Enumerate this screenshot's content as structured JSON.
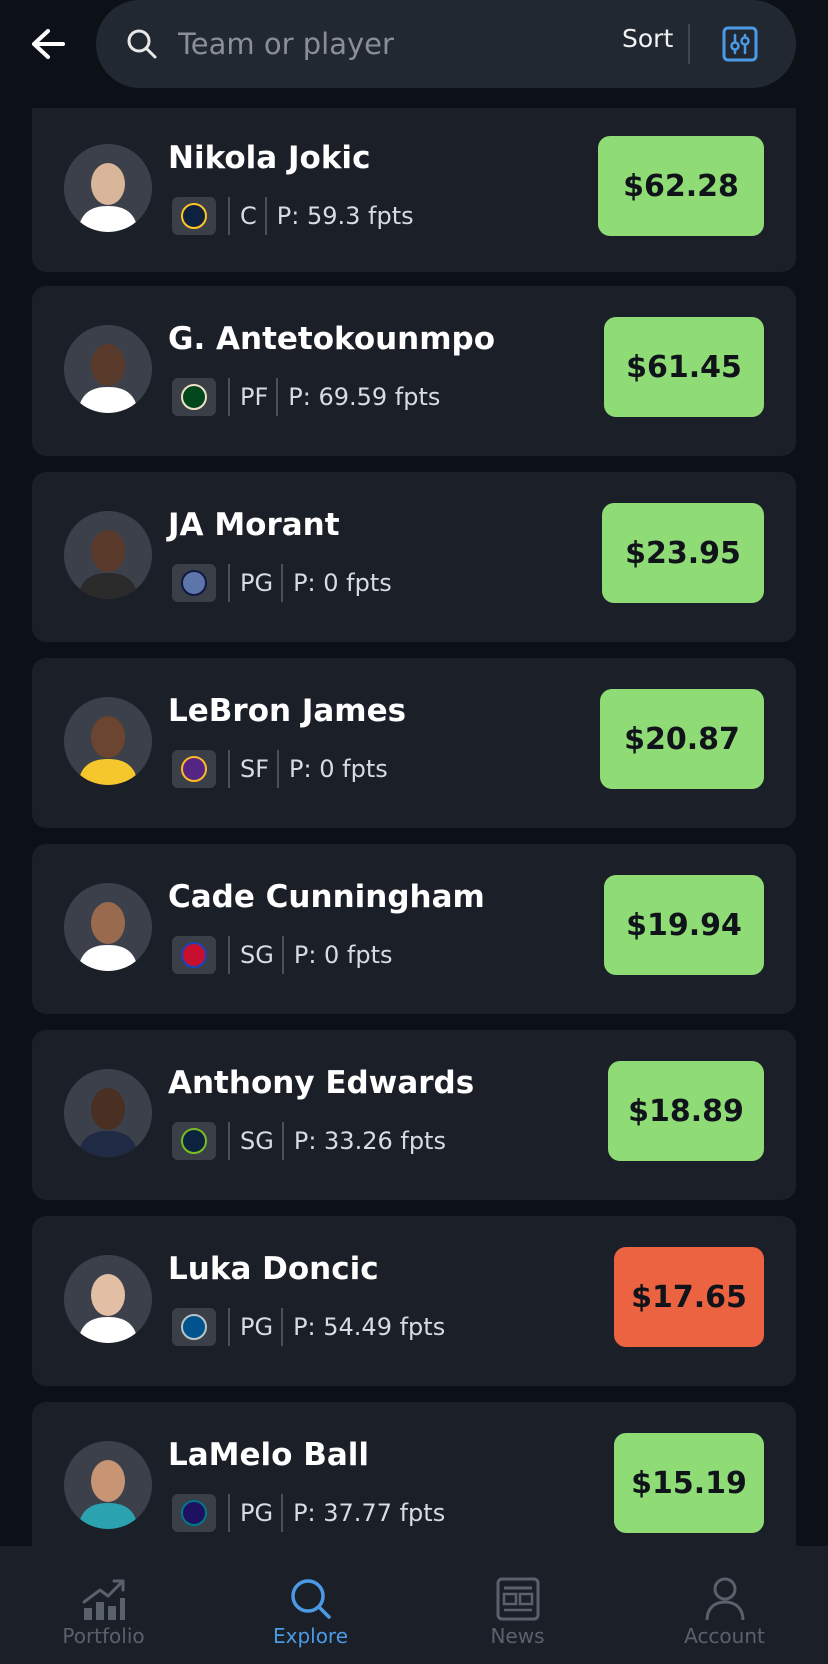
{
  "search": {
    "placeholder": "Team or player",
    "sort_label": "Sort"
  },
  "players": [
    {
      "name": "Nikola Jokic",
      "position": "C",
      "projection": "P: 59.3 fpts",
      "price": "$62.28",
      "trend": "up",
      "team_icon": "nuggets-logo-icon"
    },
    {
      "name": "G. Antetokounmpo",
      "position": "PF",
      "projection": "P: 69.59 fpts",
      "price": "$61.45",
      "trend": "up",
      "team_icon": "bucks-logo-icon"
    },
    {
      "name": "JA Morant",
      "position": "PG",
      "projection": "P: 0 fpts",
      "price": "$23.95",
      "trend": "up",
      "team_icon": "grizzlies-logo-icon"
    },
    {
      "name": "LeBron James",
      "position": "SF",
      "projection": "P: 0 fpts",
      "price": "$20.87",
      "trend": "up",
      "team_icon": "lakers-logo-icon"
    },
    {
      "name": "Cade Cunningham",
      "position": "SG",
      "projection": "P: 0 fpts",
      "price": "$19.94",
      "trend": "up",
      "team_icon": "pistons-logo-icon"
    },
    {
      "name": "Anthony Edwards",
      "position": "SG",
      "projection": "P: 33.26 fpts",
      "price": "$18.89",
      "trend": "up",
      "team_icon": "timberwolves-logo-icon"
    },
    {
      "name": "Luka Doncic",
      "position": "PG",
      "projection": "P: 54.49 fpts",
      "price": "$17.65",
      "trend": "down",
      "team_icon": "mavericks-logo-icon"
    },
    {
      "name": "LaMelo Ball",
      "position": "PG",
      "projection": "P: 37.77 fpts",
      "price": "$15.19",
      "trend": "up",
      "team_icon": "hornets-logo-icon"
    }
  ],
  "nav": {
    "items": [
      {
        "label": "Portfolio",
        "icon": "chart-icon"
      },
      {
        "label": "Explore",
        "icon": "search-icon",
        "active": true
      },
      {
        "label": "News",
        "icon": "newspaper-icon"
      },
      {
        "label": "Account",
        "icon": "person-icon"
      }
    ]
  },
  "colors": {
    "price_up": "#8fdc76",
    "price_down": "#ec6342",
    "accent": "#4a9ae6",
    "card": "#1b1f28",
    "background": "#0c1017"
  }
}
